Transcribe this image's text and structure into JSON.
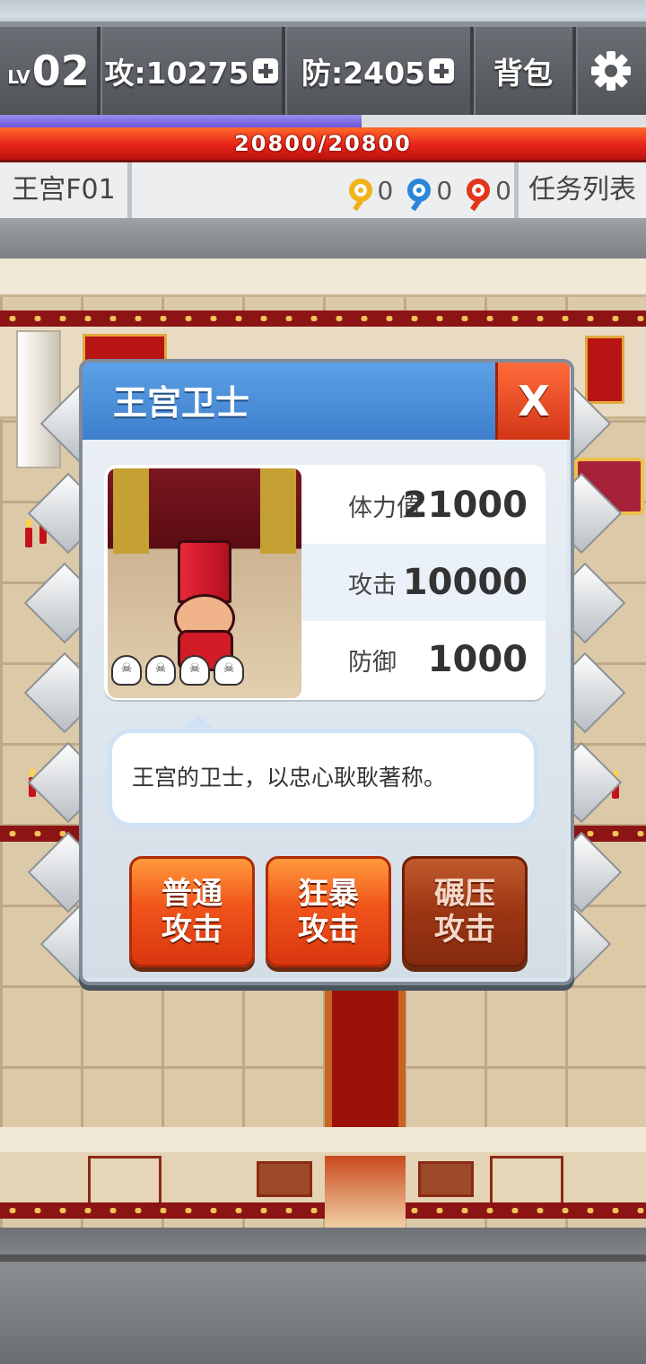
{
  "hud": {
    "level_prefix": "LV",
    "level": "02",
    "attack": "攻:10275",
    "defense": "防:2405",
    "bag": "背包",
    "hp": "20800/20800",
    "xp_fraction": 0.56
  },
  "info": {
    "floor": "王宫F01",
    "keys": [
      {
        "color": "#f2b21a",
        "count": "0"
      },
      {
        "color": "#2a86d8",
        "count": "0"
      },
      {
        "color": "#e2361c",
        "count": "0"
      }
    ],
    "task_list": "任务列表"
  },
  "dialog": {
    "title": "王宫卫士",
    "close": "X",
    "stats": [
      {
        "label": "体力值",
        "value": "21000"
      },
      {
        "label": "攻击",
        "value": "10000"
      },
      {
        "label": "防御",
        "value": "1000"
      }
    ],
    "description": "王宫的卫士，以忠心耿耿著称。",
    "buttons": {
      "normal": "普通攻击",
      "rage": "狂暴攻击",
      "crush": "碾压攻击"
    }
  },
  "colors": {
    "hp_bar": "#e8231a",
    "xp_bar": "#7b66e0",
    "dialog_header": "#4a8ad6",
    "close_button": "#e04a22"
  }
}
